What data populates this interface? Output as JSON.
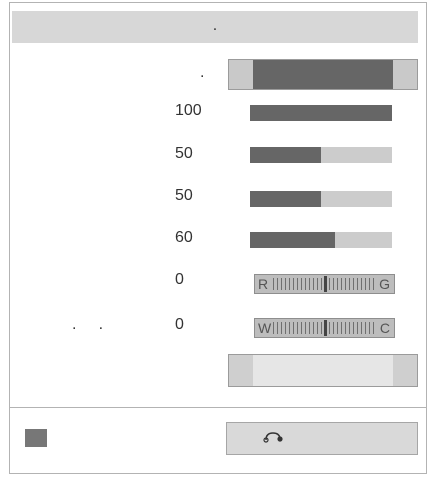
{
  "panel": {
    "title": ".",
    "mode_label": ".",
    "rows": [
      {
        "value": "100",
        "level": 1.0
      },
      {
        "value": "50",
        "level": 0.5
      },
      {
        "value": "50",
        "level": 0.5
      },
      {
        "value": "60",
        "level": 0.6
      }
    ],
    "balance_rg": {
      "value": "0",
      "left": "R",
      "right": "G"
    },
    "balance_wc": {
      "label_dots": ".     .",
      "value": "0",
      "left": "W",
      "right": "C"
    }
  },
  "colors": {
    "dark": "#666666",
    "light": "#cccccc"
  },
  "icons": {
    "back": "return-arrow-icon"
  }
}
